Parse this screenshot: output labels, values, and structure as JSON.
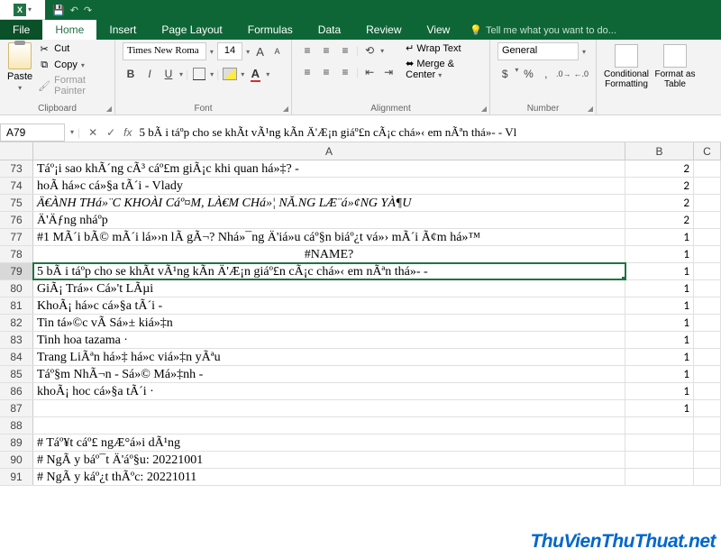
{
  "titlebar": {
    "app_icon": "X"
  },
  "tabs": {
    "file": "File",
    "home": "Home",
    "insert": "Insert",
    "page_layout": "Page Layout",
    "formulas": "Formulas",
    "data": "Data",
    "review": "Review",
    "view": "View",
    "tell_me": "Tell me what you want to do..."
  },
  "ribbon": {
    "clipboard": {
      "label": "Clipboard",
      "paste": "Paste",
      "cut": "Cut",
      "copy": "Copy",
      "format_painter": "Format Painter"
    },
    "font": {
      "label": "Font",
      "name": "Times New Roma",
      "size": "14"
    },
    "alignment": {
      "label": "Alignment",
      "wrap": "Wrap Text",
      "merge": "Merge & Center"
    },
    "number": {
      "label": "Number",
      "format": "General"
    },
    "styles": {
      "conditional": "Conditional Formatting",
      "format_table": "Format as Table"
    }
  },
  "formula_bar": {
    "name_box": "A79",
    "formula": "5 bÃ i táº­p cho se khÃ­t vÃ¹ng kÃ­n Ä'Æ¡n giáº£n cÃ¡c chá»‹ em nÃªn thá»­- - Vl"
  },
  "cols": {
    "A": "A",
    "B": "B",
    "C": "C"
  },
  "rows": [
    {
      "n": "73",
      "a": "Táº¡i sao khÃ´ng cÃ³ cáº£m giÃ¡c khi quan há»‡? -",
      "b": "2"
    },
    {
      "n": "74",
      "a": "hoÃ  há»c cá»§a tÃ´i - Vlady",
      "b": "2"
    },
    {
      "n": "75",
      "a": "Ä€ÀNH THá»¨C KHOÀI Cáº¤M, LÀ€M CHá»¦ NĂ.NG LÆ¨á»¢NG YÀ¶U",
      "b": "2",
      "cursive": true
    },
    {
      "n": "76",
      "a": "Ä'Äƒng nháº­p",
      "b": "2"
    },
    {
      "n": "77",
      "a": "#1 MÃ´i bÃ© mÃ´i lá»›n lÃ  gÃ¬? Nhá»¯ng Ä'iá»u cáº§n biáº¿t vá»› mÃ´i Ã¢m há»™",
      "b": "1"
    },
    {
      "n": "78",
      "a": "#NAME?",
      "b": "1",
      "center": true
    },
    {
      "n": "79",
      "a": "5 bÃ i táº­p cho se khÃ­t vÃ¹ng kÃ­n Ä'Æ¡n giáº£n cÃ¡c chá»‹ em nÃªn thá»­- -",
      "b": "1",
      "sel": true
    },
    {
      "n": "80",
      "a": "GiÃ¡ Trá»‹ Cá»'t LÃµi",
      "b": "1"
    },
    {
      "n": "81",
      "a": "KhoÃ¡ há»c cá»§a tÃ´i -",
      "b": "1"
    },
    {
      "n": "82",
      "a": "Tin tá»©c vÃ  Sá»± kiá»‡n",
      "b": "1"
    },
    {
      "n": "83",
      "a": "Tinh hoa tazama ·",
      "b": "1"
    },
    {
      "n": "84",
      "a": "Trang LiÃªn há»‡ há»c viá»‡n yÃªu",
      "b": "1"
    },
    {
      "n": "85",
      "a": "Táº§m NhÃ¬n - Sá»© Má»‡nh -",
      "b": "1"
    },
    {
      "n": "86",
      "a": "khoÃ¡ hoc cá»§a tÃ´i ·",
      "b": "1"
    },
    {
      "n": "87",
      "a": "",
      "b": "1"
    },
    {
      "n": "88",
      "a": "",
      "b": ""
    },
    {
      "n": "89",
      "a": "# Táº¥t cáº£ ngÆ°á»i dÃ¹ng",
      "b": ""
    },
    {
      "n": "90",
      "a": "# NgÃ y báº¯t Ä'áº§u: 20221001",
      "b": ""
    },
    {
      "n": "91",
      "a": "# NgÃ y káº¿t thÃºc: 20221011",
      "b": ""
    }
  ],
  "watermark": "ThuVienThuThuat.net"
}
